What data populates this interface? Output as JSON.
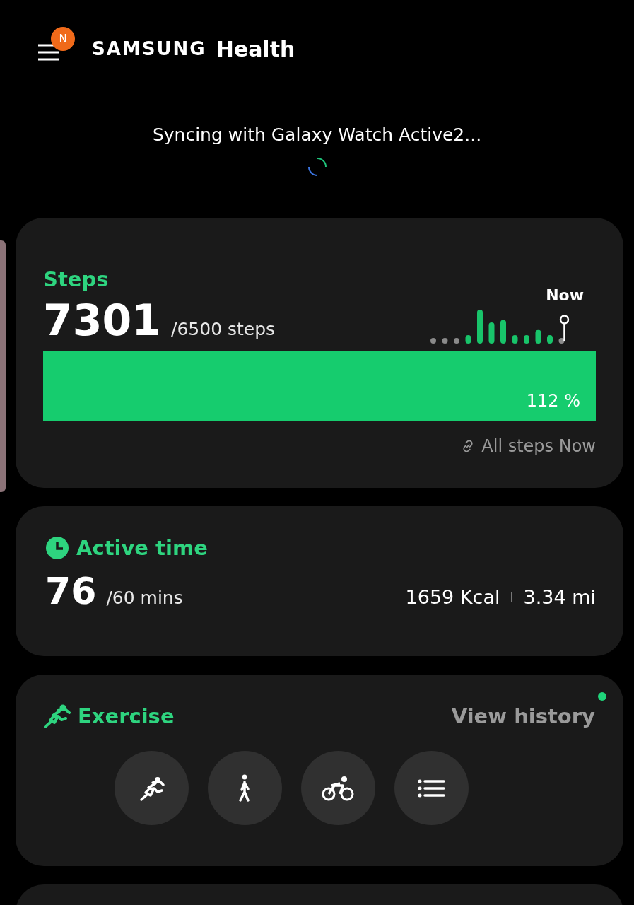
{
  "app": {
    "badge": "N",
    "brand": "SAMSUNG",
    "title": "Health"
  },
  "sync": {
    "message": "Syncing with Galaxy Watch Active2..."
  },
  "steps": {
    "title": "Steps",
    "count": "7301",
    "goal": "/6500 steps",
    "chart_marker": "Now",
    "level": 1,
    "percent": "112 %",
    "link": "All steps Now"
  },
  "active_time": {
    "title": "Active time",
    "value": "76",
    "goal": "/60 mins",
    "calories": "1659 Kcal",
    "distance": "3.34 mi"
  },
  "exercise": {
    "title": "Exercise",
    "action": "View history",
    "new_dot": true,
    "buttons": [
      {
        "kind": "run"
      },
      {
        "kind": "walk"
      },
      {
        "kind": "cycle"
      },
      {
        "kind": "list"
      }
    ]
  }
}
